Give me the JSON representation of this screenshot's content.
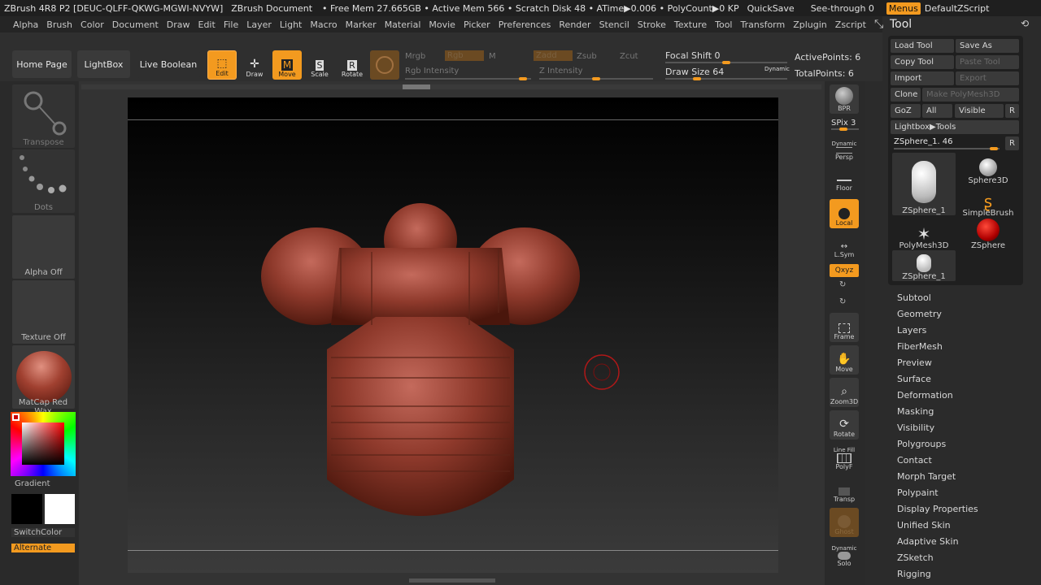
{
  "titlebar": {
    "app": "ZBrush 4R8 P2 [DEUC-QLFF-QKWG-MGWI-NVYW]",
    "doc": "ZBrush Document",
    "mem": "• Free Mem 27.665GB • Active Mem 566 • Scratch Disk 48 • ATime▶0.006 • PolyCount▶0 KP",
    "quicksave": "QuickSave",
    "seethrough": "See-through  0",
    "menus": "Menus",
    "zscript": "DefaultZScript"
  },
  "menus": [
    "Alpha",
    "Brush",
    "Color",
    "Document",
    "Draw",
    "Edit",
    "File",
    "Layer",
    "Light",
    "Macro",
    "Marker",
    "Material",
    "Movie",
    "Picker",
    "Preferences",
    "Render",
    "Stencil",
    "Stroke",
    "Texture",
    "Tool",
    "Transform",
    "Zplugin",
    "Zscript"
  ],
  "shelf": {
    "home": "Home Page",
    "lightbox": "LightBox",
    "liveboolean": "Live Boolean",
    "edit": "Edit",
    "draw": "Draw",
    "move": "Move",
    "scale": "Scale",
    "rotate": "Rotate",
    "mrgb": "Mrgb",
    "rgb": "Rgb",
    "m": "M",
    "zadd": "Zadd",
    "zsub": "Zsub",
    "zcut": "Zcut",
    "rgb_intensity": "Rgb Intensity",
    "z_intensity": "Z Intensity",
    "focal_shift": "Focal Shift 0",
    "draw_size": "Draw Size 64",
    "dynamic": "Dynamic",
    "active_points": "ActivePoints: 6",
    "total_points": "TotalPoints: 6"
  },
  "left": {
    "transpose": "Transpose",
    "dots": "Dots",
    "alpha_off": "Alpha Off",
    "texture_off": "Texture Off",
    "matcap": "MatCap Red Wax",
    "gradient": "Gradient",
    "switchcolor": "SwitchColor",
    "alternate": "Alternate"
  },
  "right": {
    "bpr": "BPR",
    "spix": "SPix 3",
    "persp": "Persp",
    "dynamic": "Dynamic",
    "floor": "Floor",
    "local": "Local",
    "lsym": "L.Sym",
    "xyz": "Qxyz",
    "frame": "Frame",
    "move": "Move",
    "zoom3d": "Zoom3D",
    "rotate": "Rotate",
    "linefill": "Line Fill",
    "polyf": "PolyF",
    "transp": "Transp",
    "ghost": "Ghost",
    "solo": "Solo"
  },
  "tool": {
    "title": "Tool",
    "load": "Load Tool",
    "saveas": "Save As",
    "copy": "Copy Tool",
    "paste": "Paste Tool",
    "import": "Import",
    "export": "Export",
    "clone": "Clone",
    "makepolymesh": "Make PolyMesh3D",
    "goz": "GoZ",
    "all": "All",
    "visible": "Visible",
    "r": "R",
    "lightbox_tools": "Lightbox▶Tools",
    "current": "ZSphere_1. 46",
    "r2": "R",
    "thumbs": [
      "ZSphere_1",
      "Sphere3D",
      "SimpleBrush",
      "PolyMesh3D",
      "ZSphere",
      "ZSphere_1"
    ],
    "items": [
      "Subtool",
      "Geometry",
      "Layers",
      "FiberMesh",
      "Preview",
      "Surface",
      "Deformation",
      "Masking",
      "Visibility",
      "Polygroups",
      "Contact",
      "Morph Target",
      "Polypaint",
      "Display Properties",
      "Unified Skin",
      "Adaptive Skin",
      "ZSketch",
      "Rigging"
    ]
  }
}
